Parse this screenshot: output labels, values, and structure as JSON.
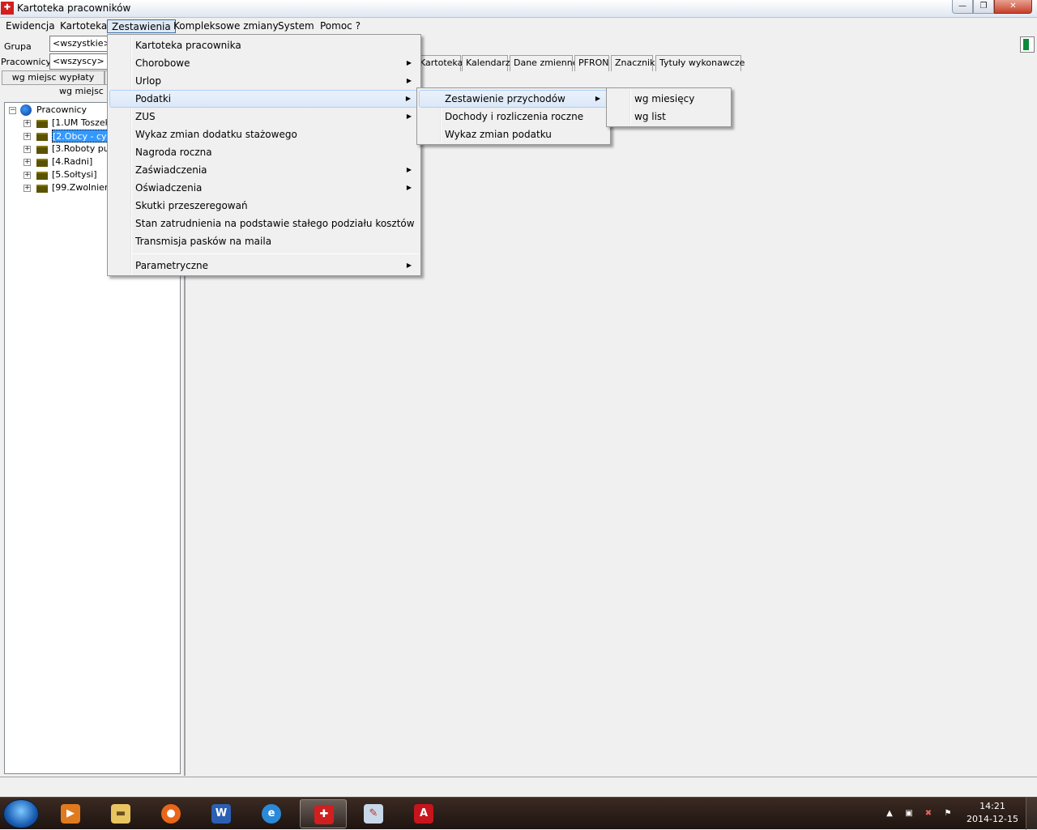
{
  "window": {
    "title": "Kartoteka pracowników",
    "app_icon": "kp-app-icon",
    "min": "—",
    "max": "❐",
    "close": "✕"
  },
  "menubar": [
    "Ewidencja",
    "Kartoteka",
    "Zestawienia",
    "Kompleksowe zmiany",
    "System",
    "Pomoc ?"
  ],
  "filters": {
    "group_label": "Grupa",
    "group_value": "<wszystkie>",
    "workers_label": "Pracownicy",
    "workers_value": "<wszyscy>",
    "btn_pay_place": "wg miejsc wypłaty",
    "btn_pay_place2": "wg miejsc pr"
  },
  "tree": {
    "root": "Pracownicy",
    "items": [
      "[1.UM Toszek]",
      "[2.Obcy - cyw",
      "[3.Roboty pub",
      "[4.Radni]",
      "[5.Sołtysi]",
      "[99.Zwolnieni]"
    ]
  },
  "tabs": [
    "Kartoteka",
    "Kalendarz",
    "Dane zmienne",
    "PFRON",
    "Znaczniki",
    "Tytuły wykonawcze"
  ],
  "menu_main": [
    {
      "label": "Kartoteka pracownika",
      "sub": false
    },
    {
      "label": "Chorobowe",
      "sub": true
    },
    {
      "label": "Urlop",
      "sub": true
    },
    {
      "label": "Podatki",
      "sub": true
    },
    {
      "label": "ZUS",
      "sub": true
    },
    {
      "label": "Wykaz zmian dodatku stażowego",
      "sub": false
    },
    {
      "label": "Nagroda roczna",
      "sub": false
    },
    {
      "label": "Zaświadczenia",
      "sub": true
    },
    {
      "label": "Oświadczenia",
      "sub": true
    },
    {
      "label": "Skutki przeszeregowań",
      "sub": false
    },
    {
      "label": "Stan zatrudnienia na podstawie stałego podziału kosztów",
      "sub": false
    },
    {
      "label": "Transmisja pasków na maila",
      "sub": false
    },
    {
      "label": "Parametryczne",
      "sub": true
    }
  ],
  "menu_podatki": [
    {
      "label": "Zestawienie przychodów",
      "sub": true
    },
    {
      "label": "Dochody i rozliczenia roczne",
      "sub": false
    },
    {
      "label": "Wykaz zmian podatku",
      "sub": false
    }
  ],
  "menu_przychody": [
    "wg miesięcy",
    "wg list"
  ],
  "taskbar": {
    "apps": [
      "media-player-icon",
      "file-explorer-icon",
      "firefox-icon",
      "word-icon",
      "internet-explorer-icon",
      "kadry-app-icon",
      "paint-icon",
      "acrobat-icon"
    ],
    "time": "14:21",
    "date": "2014-12-15"
  }
}
